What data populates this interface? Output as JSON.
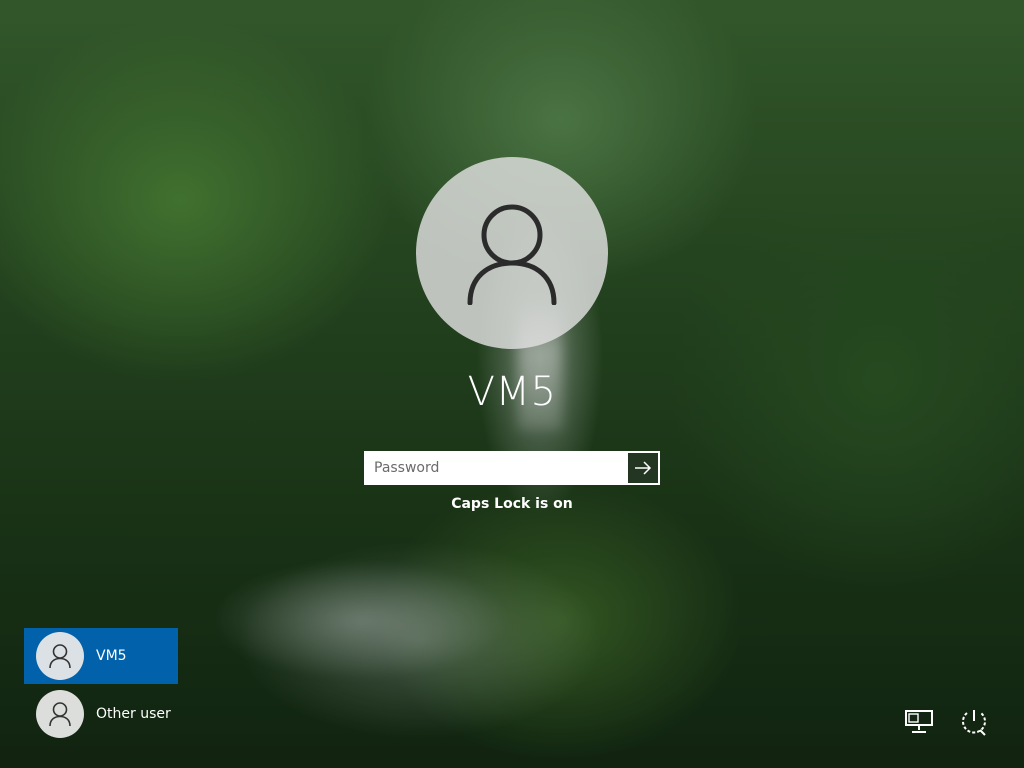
{
  "login": {
    "username": "VM5",
    "password_placeholder": "Password",
    "caps_lock_message": "Caps Lock is on",
    "submit_icon": "arrow-right-icon"
  },
  "user_list": [
    {
      "name": "VM5",
      "selected": true,
      "icon": "user-icon"
    },
    {
      "name": "Other user",
      "selected": false,
      "icon": "user-icon"
    }
  ],
  "system_buttons": [
    {
      "icon": "network-icon"
    },
    {
      "icon": "power-icon"
    }
  ],
  "colors": {
    "selected_user_bg": "#0067b8",
    "text": "#ffffff"
  }
}
